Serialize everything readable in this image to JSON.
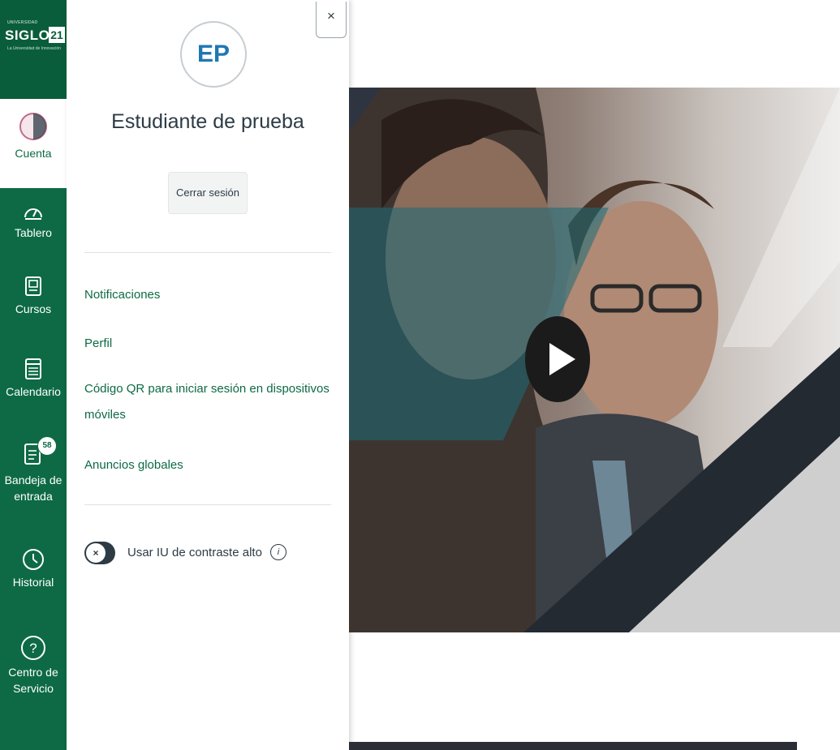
{
  "brand": {
    "logo_small": "UNIVERSIDAD",
    "logo_word": "SIGLO",
    "logo_number": "21",
    "logo_subtitle": "La Universidad de Innovación"
  },
  "nav": {
    "items": [
      {
        "label": "Cuenta",
        "icon": "account-icon",
        "active": true
      },
      {
        "label": "Tablero",
        "icon": "dashboard-icon"
      },
      {
        "label": "Cursos",
        "icon": "courses-icon"
      },
      {
        "label": "Calendario",
        "icon": "calendar-icon"
      },
      {
        "label": "Bandeja de entrada",
        "icon": "inbox-icon",
        "badge": "58"
      },
      {
        "label": "Historial",
        "icon": "history-icon"
      },
      {
        "label": "Centro de Servicio",
        "icon": "help-icon"
      }
    ]
  },
  "tray": {
    "close_label": "×",
    "avatar_initials": "EP",
    "user_name": "Estudiante de prueba",
    "logout_label": "Cerrar sesión",
    "links": [
      "Notificaciones",
      "Perfil",
      "Código QR para iniciar sesión en dispositivos móviles",
      "Anuncios globales"
    ],
    "toggle": {
      "label": "Usar IU de contraste alto",
      "knob": "×",
      "info": "i"
    }
  },
  "colors": {
    "brand_green": "#0d6a45",
    "text_dark": "#2d3b45",
    "avatar_blue": "#1f77b4"
  }
}
